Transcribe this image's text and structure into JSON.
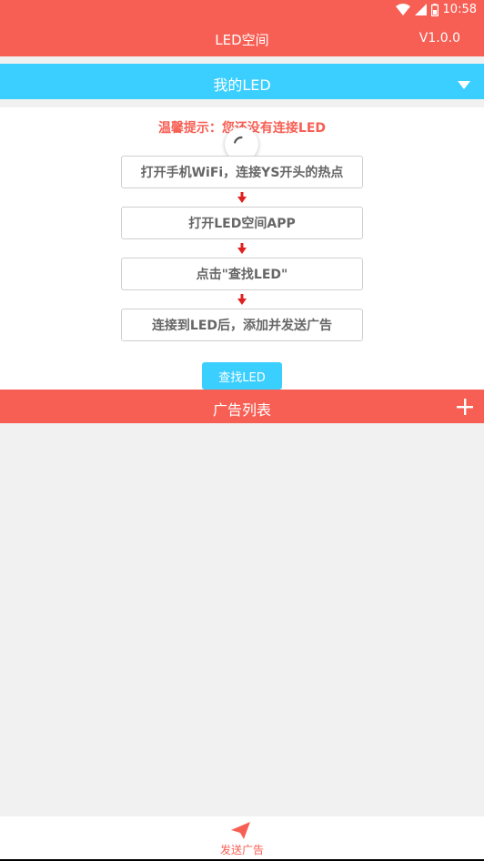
{
  "status_bar": {
    "time": "10:58",
    "icons": [
      "wifi-icon",
      "cellular-signal-icon",
      "battery-icon"
    ]
  },
  "header": {
    "title": "LED空间",
    "version": "V1.0.0"
  },
  "device": {
    "title": "我的LED",
    "dropdown_icon": "triangle-down-icon"
  },
  "guide": {
    "tip": "温馨提示：您还没有连接LED",
    "steps": [
      "打开手机WiFi，连接YS开头的热点",
      "打开LED空间APP",
      "点击\"查找LED\"",
      "连接到LED后，添加并发送广告"
    ],
    "find_button": "查找LED"
  },
  "ad_list": {
    "title": "广告列表",
    "add_icon": "plus-icon"
  },
  "bottom_nav": {
    "send_label": "发送广告",
    "send_icon": "paper-plane-icon"
  },
  "colors": {
    "primary": "#f75f54",
    "accent": "#3bcfff",
    "background": "#f1f1f1",
    "arrow": "#e02020"
  }
}
